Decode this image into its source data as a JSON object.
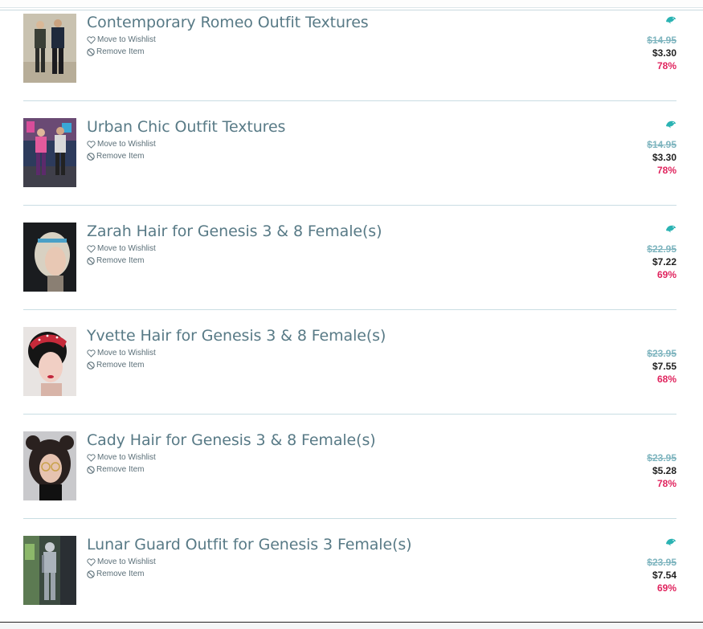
{
  "actions": {
    "wishlist_label": "Move to Wishlist",
    "remove_label": "Remove Item"
  },
  "colors": {
    "title": "#587a86",
    "original_price": "#7fb5bf",
    "discount": "#e0245e",
    "badge": "#2bb3b3"
  },
  "items": [
    {
      "title": "Contemporary Romeo Outfit Textures",
      "original_price": "$14.95",
      "sale_price": "$3.30",
      "discount": "78%",
      "badge_icon": "dolphin-icon"
    },
    {
      "title": "Urban Chic Outfit Textures",
      "original_price": "$14.95",
      "sale_price": "$3.30",
      "discount": "78%",
      "badge_icon": "dolphin-icon"
    },
    {
      "title": "Zarah Hair for Genesis 3 & 8 Female(s)",
      "original_price": "$22.95",
      "sale_price": "$7.22",
      "discount": "69%",
      "badge_icon": "dolphin-icon"
    },
    {
      "title": "Yvette Hair for Genesis 3 & 8 Female(s)",
      "original_price": "$23.95",
      "sale_price": "$7.55",
      "discount": "68%",
      "badge_icon": ""
    },
    {
      "title": "Cady Hair for Genesis 3 & 8 Female(s)",
      "original_price": "$23.95",
      "sale_price": "$5.28",
      "discount": "78%",
      "badge_icon": ""
    },
    {
      "title": "Lunar Guard Outfit for Genesis 3 Female(s)",
      "original_price": "$23.95",
      "sale_price": "$7.54",
      "discount": "69%",
      "badge_icon": "dolphin-icon"
    }
  ]
}
